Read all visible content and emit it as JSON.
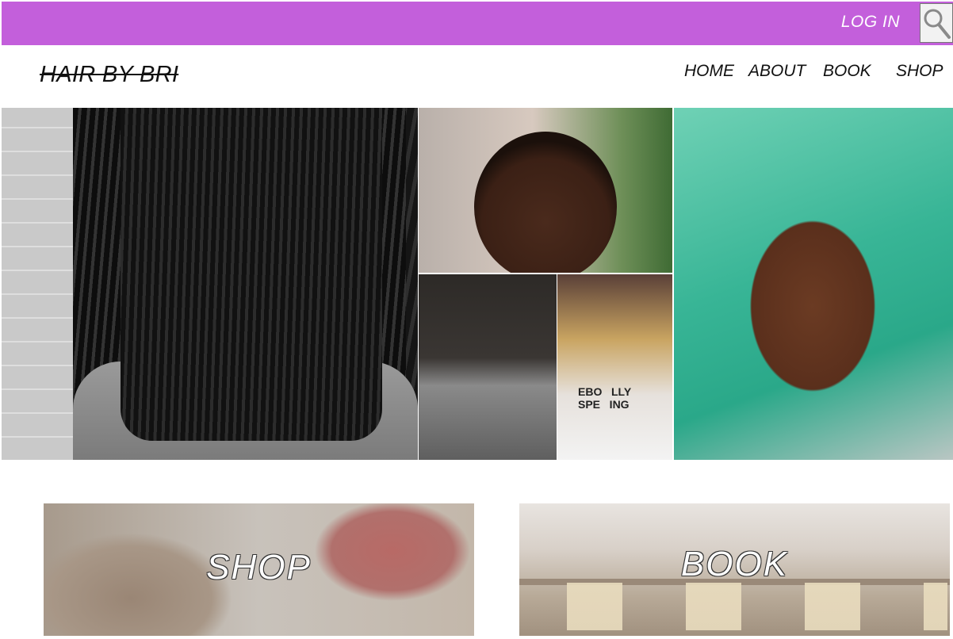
{
  "header": {
    "login_label": "LOG IN",
    "search_icon": "search-icon",
    "accent_color": "#c35fdb"
  },
  "brand": {
    "logo_text": "HAIR BY BRI"
  },
  "nav": {
    "home": "HOME",
    "about": "ABOUT",
    "book": "BOOK",
    "shop": "SHOP"
  },
  "cards": {
    "shop_label": "SHOP",
    "book_label": "BOOK"
  },
  "gallery": {
    "tee_text": "EBO   LLY\nSPE   ING"
  }
}
